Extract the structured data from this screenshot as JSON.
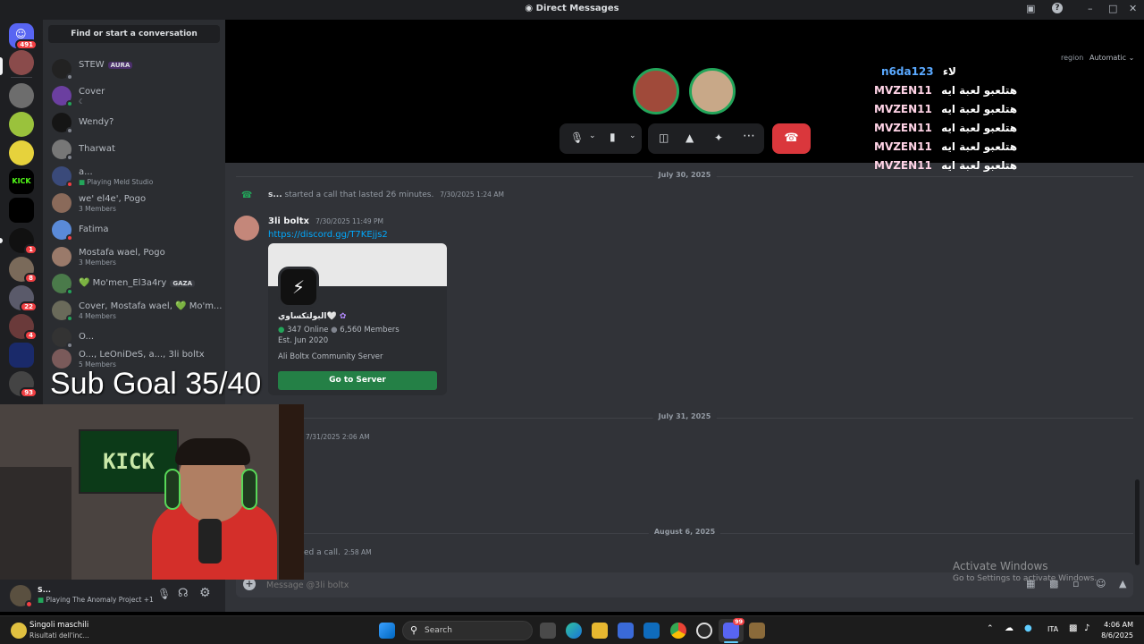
{
  "window": {
    "title": "Direct Messages"
  },
  "rail": {
    "home_badge": "491",
    "badges": [
      "1",
      "8",
      "22",
      "4",
      "93"
    ],
    "kick_label": "KICK"
  },
  "sidebar": {
    "find_placeholder": "Find or start a conversation",
    "dms": [
      {
        "name": "STEW",
        "tag": "AURA",
        "sub": ""
      },
      {
        "name": "Cover",
        "tag": "",
        "sub": "☾"
      },
      {
        "name": "Wendy?",
        "tag": "",
        "sub": ""
      },
      {
        "name": "Tharwat",
        "tag": "",
        "sub": ""
      },
      {
        "name": "a...",
        "tag": "",
        "sub": "Playing Meld Studio"
      },
      {
        "name": "we' el4e', Pogo",
        "tag": "",
        "sub": "3 Members"
      },
      {
        "name": "Fatima",
        "tag": "",
        "sub": ""
      },
      {
        "name": "Mostafa wael, Pogo",
        "tag": "",
        "sub": "3 Members"
      },
      {
        "name": "💚 Mo'men_El3a4ry",
        "tag": "GAZA",
        "sub": ""
      },
      {
        "name": "Cover, Mostafa wael, 💚 Mo'm...",
        "tag": "",
        "sub": "4 Members"
      },
      {
        "name": "O...",
        "tag": "",
        "sub": ""
      },
      {
        "name": "O..., LeOniDeS, a..., 3li boltx",
        "tag": "",
        "sub": "5 Members"
      }
    ]
  },
  "user_panel": {
    "name": "S...",
    "activity": "Playing The Anomaly Project +1"
  },
  "call": {
    "region_label": "region",
    "region_value": "Automatic"
  },
  "chat": {
    "dividers": [
      "July 30, 2025",
      "July 31, 2025",
      "August 6, 2025"
    ],
    "call_event": {
      "user": "s...",
      "text": "started a call that lasted 26 minutes.",
      "time": "7/30/2025 1:24 AM"
    },
    "message": {
      "author": "3li boltx",
      "time": "7/30/2025 11:49 PM",
      "link": "https://discord.gg/T7KEjjs2"
    },
    "invite": {
      "server_name": "البولتكساوي🤍",
      "online": "347 Online",
      "members": "6,560 Members",
      "est": "Est. Jun 2020",
      "desc": "Ali Boltx Community Server",
      "button": "Go to Server"
    },
    "july31_time": "7/31/2025 2:06 AM",
    "missed_call": {
      "text": "ed a call.",
      "time": "2:58 AM"
    },
    "message_placeholder": "Message @3li boltx"
  },
  "overlay": {
    "sub_goal": "Sub Goal 35/40",
    "chat_lines": [
      {
        "user": "n6da123",
        "text": "لاء",
        "color": "#5aa9ff"
      },
      {
        "user": "MVZEN11",
        "text": "هتلعبو لعبة ايه",
        "color": "#ffd3e6"
      },
      {
        "user": "MVZEN11",
        "text": "هتلعبو لعبة ايه",
        "color": "#ffd3e6"
      },
      {
        "user": "MVZEN11",
        "text": "هتلعبو لعبة ايه",
        "color": "#ffd3e6"
      },
      {
        "user": "MVZEN11",
        "text": "هتلعبو لعبة ايه",
        "color": "#ffd3e6"
      },
      {
        "user": "MVZEN11",
        "text": "هتلعبو لعبة ايه",
        "color": "#ffd3e6"
      }
    ],
    "webcam_banner": "KICK",
    "activate_title": "Activate Windows",
    "activate_sub": "Go to Settings to activate Windows."
  },
  "taskbar": {
    "media_title": "Singoli maschili",
    "media_sub": "Risultati dell'inc...",
    "search_placeholder": "Search",
    "discord_badge": "99",
    "lang": "ITA",
    "time": "4:06 AM",
    "date": "8/6/2025"
  },
  "colors": {
    "accent_red": "#da373c",
    "success_green": "#248046",
    "link_blue": "#00a8fc"
  }
}
